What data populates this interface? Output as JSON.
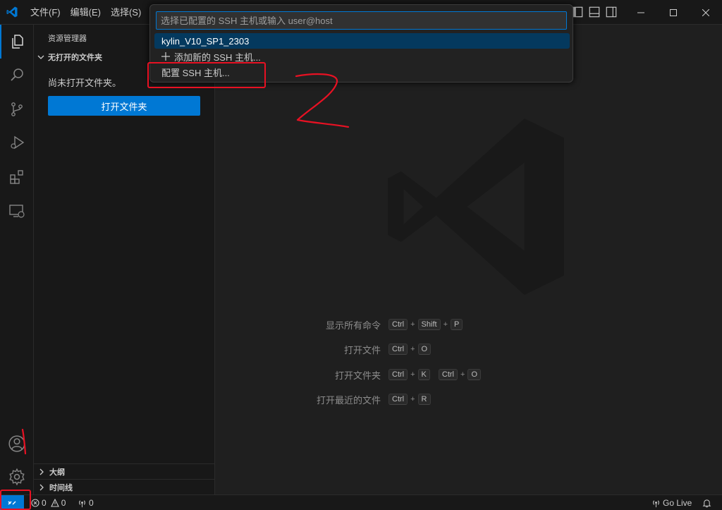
{
  "menu": {
    "file": "文件(F)",
    "edit": "编辑(E)",
    "select": "选择(S)"
  },
  "sidebar": {
    "title": "资源管理器",
    "section": "无打开的文件夹",
    "message": "尚未打开文件夹。",
    "open_folder_button": "打开文件夹",
    "outline": "大纲",
    "timeline": "时间线"
  },
  "quickpick": {
    "placeholder": "选择已配置的 SSH 主机或输入 user@host",
    "items": [
      "kylin_V10_SP1_2303",
      "添加新的 SSH 主机...",
      "配置 SSH 主机..."
    ],
    "add_icon": "plus-icon"
  },
  "shortcuts": [
    {
      "label": "显示所有命令",
      "keys": [
        "Ctrl",
        "Shift",
        "P"
      ]
    },
    {
      "label": "打开文件",
      "keys": [
        "Ctrl",
        "O"
      ]
    },
    {
      "label": "打开文件夹",
      "keys": [
        "Ctrl",
        "K"
      ],
      "keys2": [
        "Ctrl",
        "O"
      ]
    },
    {
      "label": "打开最近的文件",
      "keys": [
        "Ctrl",
        "R"
      ]
    }
  ],
  "statusbar": {
    "errors": "0",
    "warnings": "0",
    "ports": "0",
    "go_live": "Go Live"
  },
  "annotation": {
    "number": "2",
    "color": "#e81123"
  },
  "colors": {
    "accent": "#0078d4",
    "selection": "#04395e"
  }
}
